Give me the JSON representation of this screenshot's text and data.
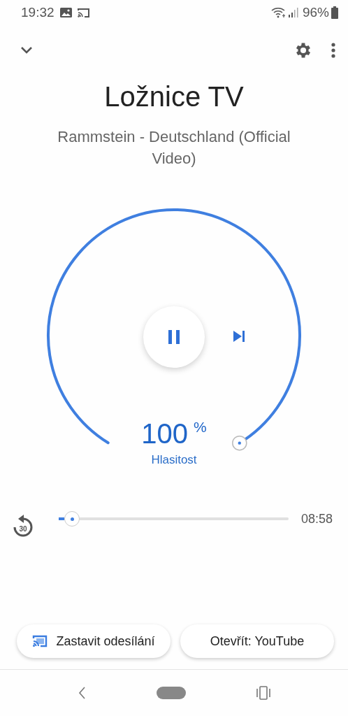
{
  "status_bar": {
    "time": "19:32",
    "battery": "96%"
  },
  "device": {
    "title": "Ložnice TV",
    "subtitle": "Rammstein - Deutschland (Official Video)"
  },
  "volume": {
    "value": "100",
    "unit": "%",
    "label": "Hlasitost"
  },
  "playback": {
    "playing": true,
    "duration": "08:58",
    "rewind_label": "30"
  },
  "buttons": [
    {
      "label": "Zastavit odesílání",
      "kind": "cast"
    },
    {
      "label": "Otevřít: YouTube",
      "kind": "plain"
    }
  ]
}
